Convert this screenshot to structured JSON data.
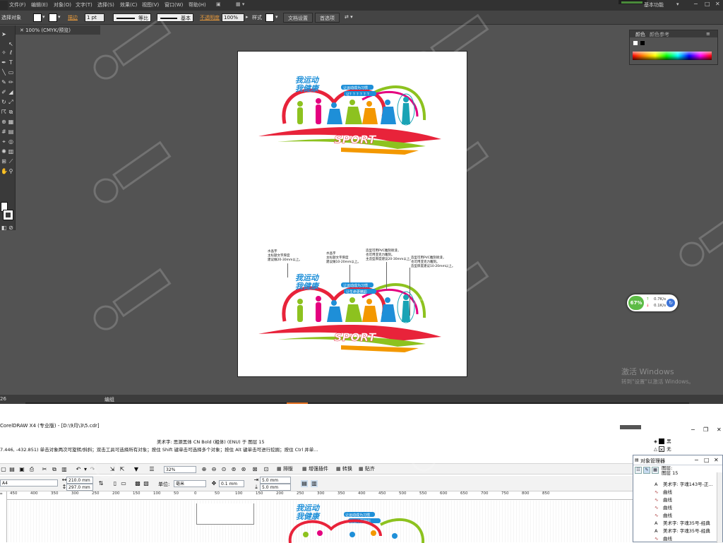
{
  "illustrator": {
    "menus": [
      "文件(F)",
      "编辑(E)",
      "对象(O)",
      "文字(T)",
      "选择(S)",
      "效果(C)",
      "视图(V)",
      "窗口(W)",
      "帮助(H)"
    ],
    "workspace": "基本功能",
    "control_bar": {
      "selection_label": "选择对象",
      "stroke_label": "描边",
      "stroke_weight": "1 pt",
      "stroke_profile": "等比",
      "brush": "基本",
      "opacity_label": "不透明度",
      "opacity_value": "100%",
      "style_label": "样式",
      "doc_setup_button": "文档设置",
      "preferences_button": "首选项"
    },
    "document_tab": "100% (CMYK/预览)",
    "panel_tabs": [
      "颜色",
      "颜色参考"
    ],
    "statusbar": {
      "zoom": "26",
      "label": "编组"
    },
    "net_monitor": {
      "percent": "67%",
      "upload": "0.7K/s",
      "download": "0.1K/s"
    },
    "activation": {
      "title": "激活 Windows",
      "subtitle": "转到\"设置\"以激活 Windows。"
    },
    "artwork": {
      "slogan_top": "我运动",
      "slogan_bottom": "我健康",
      "tag_line_1": "让运动成为习惯",
      "tag_line_2_top": "让？？？？？？",
      "tag_line_2_bottom": "让生命更精彩",
      "sport_word": "SPORT"
    },
    "annotations": [
      {
        "lines": [
          "水晶字",
          "主标题文字厚度",
          "建议做20-30mm以上。"
        ]
      },
      {
        "lines": [
          "水晶字",
          "主标题文字厚度",
          "建议做10-20mm以上。"
        ]
      },
      {
        "lines": [
          "造型可用PVC雕刻喷漆，",
          "也可用亚克力雕刻。",
          "主造型厚度建议20-30mm以上。"
        ]
      },
      {
        "lines": [
          "造型可用PVC雕刻喷漆，",
          "也可用亚克力雕刻。",
          "造型厚度建议10-20mm以上。"
        ]
      }
    ]
  },
  "coreldraw": {
    "title": "CorelDRAW X4 (专业版) - [D:\\9月\\3\\5.cdr]",
    "object_info": "美术字: 思源黑体 CN Bold (粗体) (ENU) 于 图层 15",
    "status_hint": "7.446, -432.851)  单击对象两次可旋转/斜斜；双击工具可选择所有对象；按住 Shift 键单击可选择多个对象；按住 Alt 键单击可进行挖掘；按住 Ctrl 并单...",
    "fill_label": "黑",
    "outline_label": "无",
    "toolbar": {
      "zoom": "32%",
      "import_btn": "排版",
      "plugin_btn": "增强插件",
      "convert_btn": "转换",
      "paste_btn": "贴齐"
    },
    "property_bar": {
      "page_size": "A4",
      "width": "210.0 mm",
      "height": "297.0 mm",
      "unit_label": "单位:",
      "unit_value": "毫米",
      "nudge": "0.1 mm",
      "dup_x": "5.0 mm",
      "dup_y": "5.0 mm"
    },
    "ruler_ticks": [
      "450",
      "400",
      "350",
      "300",
      "250",
      "200",
      "150",
      "100",
      "50",
      "0",
      "50",
      "100",
      "150",
      "200",
      "250",
      "300",
      "350",
      "400",
      "450",
      "500",
      "550",
      "600",
      "650",
      "700",
      "750",
      "800",
      "850"
    ],
    "object_manager": {
      "title": "对象管理器",
      "layer_text": "图层:\n图层 15",
      "rows": [
        {
          "icon": "A",
          "text": "美术字: 字魂143号-正..."
        },
        {
          "icon": "curve",
          "text": "曲线"
        },
        {
          "icon": "curve",
          "text": "曲线"
        },
        {
          "icon": "curve",
          "text": "曲线"
        },
        {
          "icon": "curve",
          "text": "曲线"
        },
        {
          "icon": "A",
          "text": "美术字: 字魂35号-经典"
        },
        {
          "icon": "A",
          "text": "美术字: 字魂35号-经典"
        },
        {
          "icon": "curve",
          "text": "曲线"
        }
      ]
    }
  },
  "colors": {
    "ai_bg": "#535353",
    "ai_dark": "#323232",
    "accent_orange": "#e06b1a",
    "logo_blue": "#1e8fd8",
    "logo_red": "#e8233a",
    "logo_green": "#8dc21f",
    "logo_orange": "#f39800",
    "logo_pink": "#e4007f"
  }
}
